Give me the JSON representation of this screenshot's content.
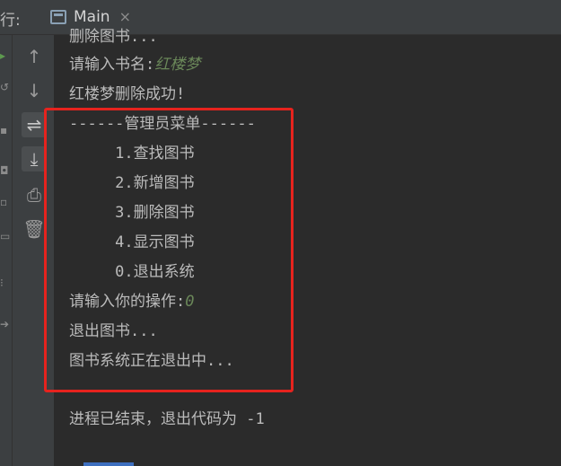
{
  "tabbar": {
    "run_label": "行:",
    "tab_title": "Main",
    "tab_close": "×"
  },
  "toolbar": {
    "buttons": [
      {
        "icon": "arrow-up-icon",
        "glyph": "↑"
      },
      {
        "icon": "arrow-down-icon",
        "glyph": "↓"
      },
      {
        "icon": "soft-wrap-icon",
        "glyph": "⇌"
      },
      {
        "icon": "scroll-to-end-icon",
        "glyph": "⤓"
      },
      {
        "icon": "print-icon",
        "glyph": "⎙"
      },
      {
        "icon": "trash-icon",
        "glyph": "🗑"
      }
    ]
  },
  "console": {
    "lines": [
      {
        "text": "删除图书..."
      },
      {
        "prompt": "请输入书名:",
        "value": "红楼梦"
      },
      {
        "text": "红楼梦删除成功!"
      },
      {
        "text": "------管理员菜单------"
      },
      {
        "text": "     1.查找图书"
      },
      {
        "text": "     2.新增图书"
      },
      {
        "text": "     3.删除图书"
      },
      {
        "text": "     4.显示图书"
      },
      {
        "text": "     0.退出系统"
      },
      {
        "prompt": "请输入你的操作:",
        "value": "0"
      },
      {
        "text": "退出图书..."
      },
      {
        "text": "图书系统正在退出中..."
      },
      {
        "text": "进程已结束，退出代码为 -1"
      }
    ]
  },
  "colors": {
    "background": "#2b2b2b",
    "panel": "#3c3f41",
    "text": "#bbbbbb",
    "input": "#6a8759",
    "highlight": "#e6231e"
  }
}
